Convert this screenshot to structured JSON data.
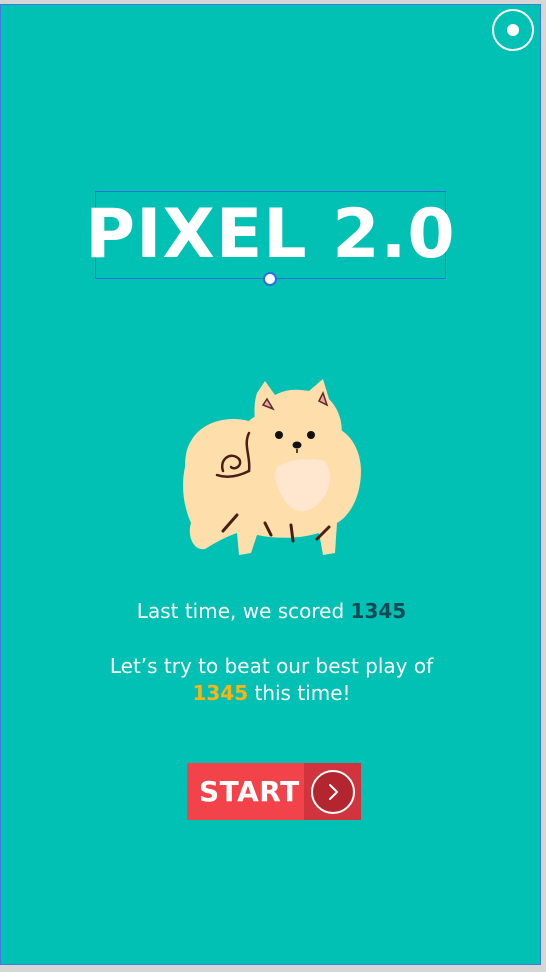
{
  "game": {
    "title": "PIXEL 2.0",
    "last_time_prefix": "Last time, we scored ",
    "last_score": "1345",
    "beat_prefix": "Let’s try to beat our best play of",
    "best_score": "1345",
    "beat_suffix": " this time!",
    "start_label": "START"
  },
  "icons": {
    "toggle": "radio-toggle-icon",
    "arrow": "chevron-right-icon",
    "mascot": "pomeranian-dog-illustration"
  },
  "colors": {
    "background": "#00c1b4",
    "title": "#ffffff",
    "score_dark": "#134a56",
    "score_gold": "#ffb30f",
    "button": "#f2434a"
  }
}
